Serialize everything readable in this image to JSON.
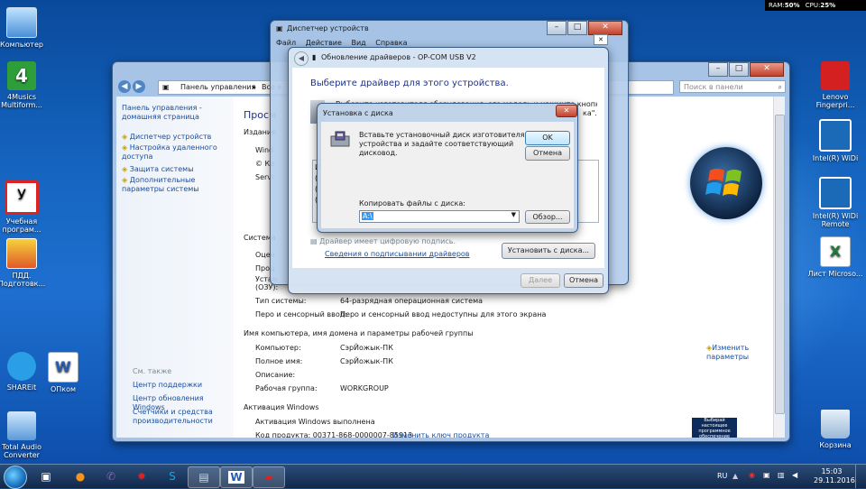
{
  "gadget": {
    "ram_label": "RAM:",
    "ram_value": "50%",
    "cpu_label": "CPU:",
    "cpu_value": "25%"
  },
  "desktop_icons_left": [
    {
      "label": "Компьютер"
    },
    {
      "label": "4Musics Multiform..."
    },
    {
      "label": "Учебная програм..."
    },
    {
      "label": "ПДД. Подготовк..."
    },
    {
      "label": "SHAREit"
    },
    {
      "label": "ОПком"
    },
    {
      "label": "Total Audio Converter"
    }
  ],
  "desktop_icons_right": [
    {
      "label": "Lenovo Fingerpri..."
    },
    {
      "label": "Intel(R) WiDi"
    },
    {
      "label": "Intel(R) WiDi Remote"
    },
    {
      "label": "Лист Microso..."
    },
    {
      "label": "Корзина"
    }
  ],
  "system_window": {
    "address": {
      "root": "Панель управления",
      "next": "Все э",
      "search_placeholder": "Поиск в панели управления"
    },
    "sidebar": {
      "home": "Панель управления - домашняя страница",
      "links": [
        "Диспетчер устройств",
        "Настройка удаленного доступа",
        "Защита системы",
        "Дополнительные параметры системы"
      ],
      "see_also": "См. также",
      "see_also_links": [
        "Центр поддержки",
        "Центр обновления Windows",
        "Счетчики и средства производительности"
      ]
    },
    "heading": "Просм",
    "edition_title": "Издание",
    "edition_rows": [
      "Wind",
      "© Ко",
      "Servi"
    ],
    "system_title": "Система",
    "system_rows_partial": [
      "Оцен",
      "Проц",
      "Устан",
      "(ОЗУ):"
    ],
    "system_rows": [
      {
        "label": "Тип системы:",
        "value": "64-разрядная операционная система"
      },
      {
        "label": "Перо и сенсорный ввод:",
        "value": "Перо и сенсорный ввод недоступны для этого экрана"
      }
    ],
    "computer_title": "Имя компьютера, имя домена и параметры рабочей группы",
    "computer_rows": [
      {
        "label": "Компьютер:",
        "value": "СэрЙожык-ПК"
      },
      {
        "label": "Полное имя:",
        "value": "СэрЙожык-ПК"
      },
      {
        "label": "Описание:",
        "value": ""
      },
      {
        "label": "Рабочая группа:",
        "value": "WORKGROUP"
      }
    ],
    "change_link": "Изменить параметры",
    "activation_title": "Активация Windows",
    "activation_status": "Активация Windows выполнена",
    "product_id": "Код продукта: 00371-868-0000007-85913",
    "change_key": "Изменить ключ продукта",
    "badge_text": "Выбирай настоящее программное обеспечение"
  },
  "devmgr_window": {
    "title": "Диспетчер устройств",
    "menu": [
      "Файл",
      "Действие",
      "Вид",
      "Справка"
    ]
  },
  "update_dialog": {
    "title": "Обновление драйверов - OP-COM USB V2",
    "heading": "Выберите драйвер для этого устройства.",
    "instruction": "Выберите изготовителя оборудования, его модель и нажмите кнопку \"Далее\". Если",
    "instruction2": "ка\".",
    "list_partial": [
      "И",
      "(",
      "(",
      "("
    ],
    "signed_text": "Драйвер имеет цифровую подпись.",
    "signing_link": "Сведения о подписывании драйверов",
    "install_from_disk": "Установить с диска...",
    "next": "Далее",
    "cancel": "Отмена"
  },
  "disk_dialog": {
    "title": "Установка с диска",
    "message": "Вставьте установочный диск изготовителя устройства и задайте соответствующий дисковод.",
    "ok": "OK",
    "cancel": "Отмена",
    "copy_label": "Копировать файлы с диска:",
    "path_value": "A:\\",
    "browse": "Обзор..."
  },
  "taskbar": {
    "lang": "RU",
    "time": "15:03",
    "date": "29.11.2016"
  }
}
